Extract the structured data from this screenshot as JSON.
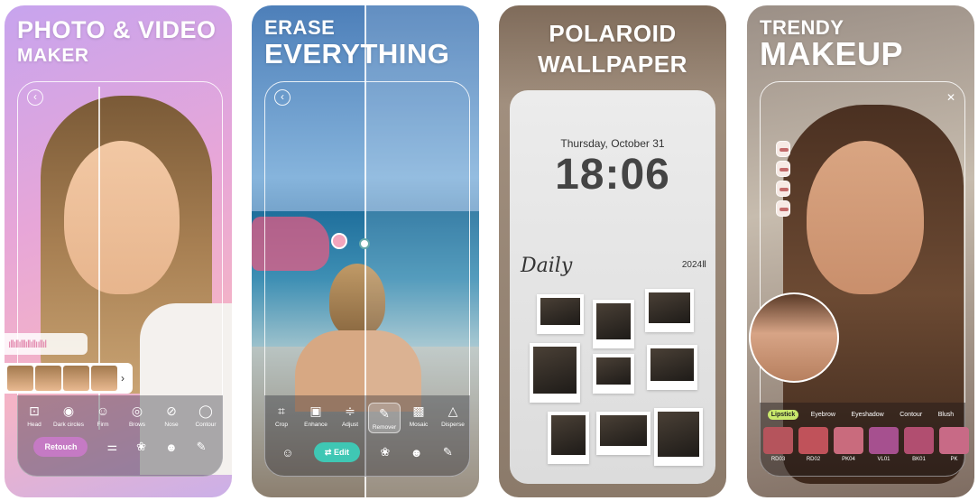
{
  "cards": [
    {
      "headline": [
        "PHOTO & VIDEO",
        "MAKER"
      ],
      "audio_wave": "ıllıllılllıllıllııllıl",
      "tools": [
        {
          "icon": "⊡",
          "label": "Head"
        },
        {
          "icon": "◉",
          "label": "Dark circles"
        },
        {
          "icon": "☺",
          "label": "Firm"
        },
        {
          "icon": "◎",
          "label": "Brows"
        },
        {
          "icon": "⊘",
          "label": "Nose"
        },
        {
          "icon": "◯",
          "label": "Contour"
        }
      ],
      "pill_label": "Retouch"
    },
    {
      "headline": [
        "ERASE",
        "EVERYTHING"
      ],
      "tools": [
        {
          "icon": "⌗",
          "label": "Crop"
        },
        {
          "icon": "▣",
          "label": "Enhance"
        },
        {
          "icon": "≑",
          "label": "Adjust"
        },
        {
          "icon": "✎",
          "label": "Remover"
        },
        {
          "icon": "▩",
          "label": "Mosaic"
        },
        {
          "icon": "△",
          "label": "Disperse"
        }
      ],
      "pill_label": "⇄ Edit"
    },
    {
      "headline": [
        "POLAROID",
        "WALLPAPER"
      ],
      "lock_date": "Thursday, October 31",
      "lock_time": "18:06",
      "script_word": "Daily",
      "year": "2024Ⅱ"
    },
    {
      "headline": [
        "TRENDY",
        "MAKEUP"
      ],
      "categories": [
        "Lipstick",
        "Eyebrow",
        "Eyeshadow",
        "Contour",
        "Blush"
      ],
      "swatches": [
        {
          "code": "RD03",
          "color": "#b5545c"
        },
        {
          "code": "RD02",
          "color": "#c0525a"
        },
        {
          "code": "PK04",
          "color": "#c96b7d"
        },
        {
          "code": "VL01",
          "color": "#a6508f"
        },
        {
          "code": "BK01",
          "color": "#b14e70"
        },
        {
          "code": "PK",
          "color": "#c86a86"
        }
      ]
    }
  ]
}
